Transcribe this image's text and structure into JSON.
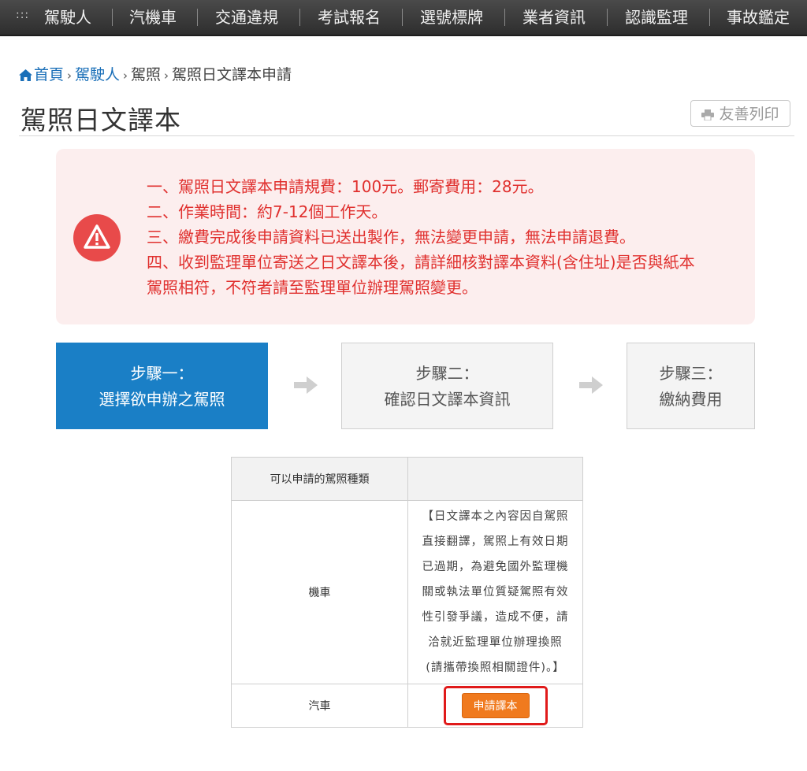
{
  "nav": {
    "menu_glyph": ":::",
    "items": [
      "駕駛人",
      "汽機車",
      "交通違規",
      "考試報名",
      "選號標牌",
      "業者資訊",
      "認識監理",
      "事故鑑定"
    ]
  },
  "breadcrumb": {
    "home": "首頁",
    "level1": "駕駛人",
    "level2": "駕照",
    "current": "駕照日文譯本申請",
    "separator": "›"
  },
  "page": {
    "title": "駕照日文譯本",
    "print_label": "友善列印"
  },
  "alert": {
    "lines": [
      "一、駕照日文譯本申請規費：100元。郵寄費用：28元。",
      "二、作業時間：約7-12個工作天。",
      "三、繳費完成後申請資料已送出製作，無法變更申請，無法申請退費。",
      "四、收到監理單位寄送之日文譯本後，請詳細核對譯本資料(含住址)是否與紙本",
      "駕照相符，不符者請至監理單位辦理駕照變更。"
    ]
  },
  "steps": [
    {
      "line1": "步驟一：",
      "line2": "選擇欲申辦之駕照"
    },
    {
      "line1": "步驟二：",
      "line2": "確認日文譯本資訊"
    },
    {
      "line1": "步驟三：",
      "line2": "繳納費用"
    }
  ],
  "table": {
    "header": "可以申請的駕照種類",
    "header2": "",
    "rows": [
      {
        "type": "機車",
        "note_lines": [
          "【日文譯本之內容因自駕照",
          "直接翻譯，駕照上有效日期",
          "已過期，為避免國外監理機",
          "關或執法單位質疑駕照有效",
          "性引發爭議，造成不便，請",
          "洽就近監理單位辦理換照",
          "(請攜帶換照相關證件)。】"
        ]
      },
      {
        "type": "汽車",
        "button": "申請譯本"
      }
    ]
  },
  "colors": {
    "nav_bg": "#333333",
    "link": "#1a6fb8",
    "alert_text": "#e0302e",
    "alert_bg": "#fceeee",
    "active_step": "#1a7fc6",
    "apply_button": "#f07a1e",
    "highlight": "#e01a1a"
  }
}
